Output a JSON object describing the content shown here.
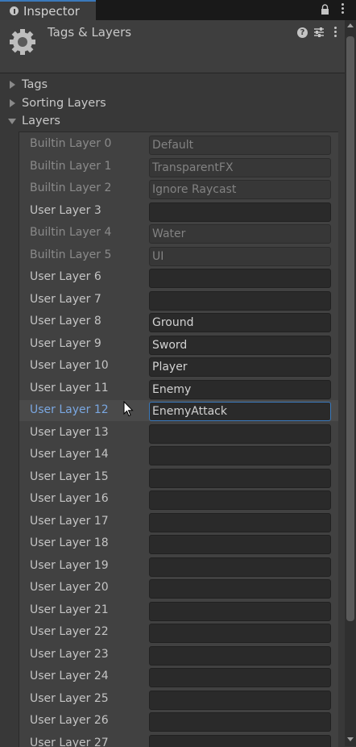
{
  "window": {
    "tab_title": "Inspector",
    "tab_icon": "info-icon",
    "lock_icon": "lock-icon",
    "menu_icon": "kebab-menu-icon"
  },
  "header": {
    "title": "Tags & Layers",
    "icon": "gear-icon",
    "help_icon": "question-icon",
    "preset_icon": "preset-sliders-icon",
    "menu_icon": "kebab-menu-icon"
  },
  "sections": {
    "tags": {
      "label": "Tags",
      "expanded": false
    },
    "sorting_layers": {
      "label": "Sorting Layers",
      "expanded": false
    },
    "layers": {
      "label": "Layers",
      "expanded": true
    }
  },
  "layers": [
    {
      "label": "Builtin Layer 0",
      "value": "Default",
      "builtin": true
    },
    {
      "label": "Builtin Layer 1",
      "value": "TransparentFX",
      "builtin": true
    },
    {
      "label": "Builtin Layer 2",
      "value": "Ignore Raycast",
      "builtin": true
    },
    {
      "label": "User Layer 3",
      "value": "",
      "builtin": false
    },
    {
      "label": "Builtin Layer 4",
      "value": "Water",
      "builtin": true
    },
    {
      "label": "Builtin Layer 5",
      "value": "UI",
      "builtin": true
    },
    {
      "label": "User Layer 6",
      "value": "",
      "builtin": false
    },
    {
      "label": "User Layer 7",
      "value": "",
      "builtin": false
    },
    {
      "label": "User Layer 8",
      "value": "Ground",
      "builtin": false
    },
    {
      "label": "User Layer 9",
      "value": "Sword",
      "builtin": false
    },
    {
      "label": "User Layer 10",
      "value": "Player",
      "builtin": false
    },
    {
      "label": "User Layer 11",
      "value": "Enemy",
      "builtin": false
    },
    {
      "label": "User Layer 12",
      "value": "EnemyAttack",
      "builtin": false,
      "focused": true
    },
    {
      "label": "User Layer 13",
      "value": "",
      "builtin": false
    },
    {
      "label": "User Layer 14",
      "value": "",
      "builtin": false
    },
    {
      "label": "User Layer 15",
      "value": "",
      "builtin": false
    },
    {
      "label": "User Layer 16",
      "value": "",
      "builtin": false
    },
    {
      "label": "User Layer 17",
      "value": "",
      "builtin": false
    },
    {
      "label": "User Layer 18",
      "value": "",
      "builtin": false
    },
    {
      "label": "User Layer 19",
      "value": "",
      "builtin": false
    },
    {
      "label": "User Layer 20",
      "value": "",
      "builtin": false
    },
    {
      "label": "User Layer 21",
      "value": "",
      "builtin": false
    },
    {
      "label": "User Layer 22",
      "value": "",
      "builtin": false
    },
    {
      "label": "User Layer 23",
      "value": "",
      "builtin": false
    },
    {
      "label": "User Layer 24",
      "value": "",
      "builtin": false
    },
    {
      "label": "User Layer 25",
      "value": "",
      "builtin": false
    },
    {
      "label": "User Layer 26",
      "value": "",
      "builtin": false
    },
    {
      "label": "User Layer 27",
      "value": "",
      "builtin": false
    }
  ],
  "colors": {
    "accent": "#3a79bb",
    "active_label": "#7aa7e0",
    "panel_bg": "#383838"
  }
}
